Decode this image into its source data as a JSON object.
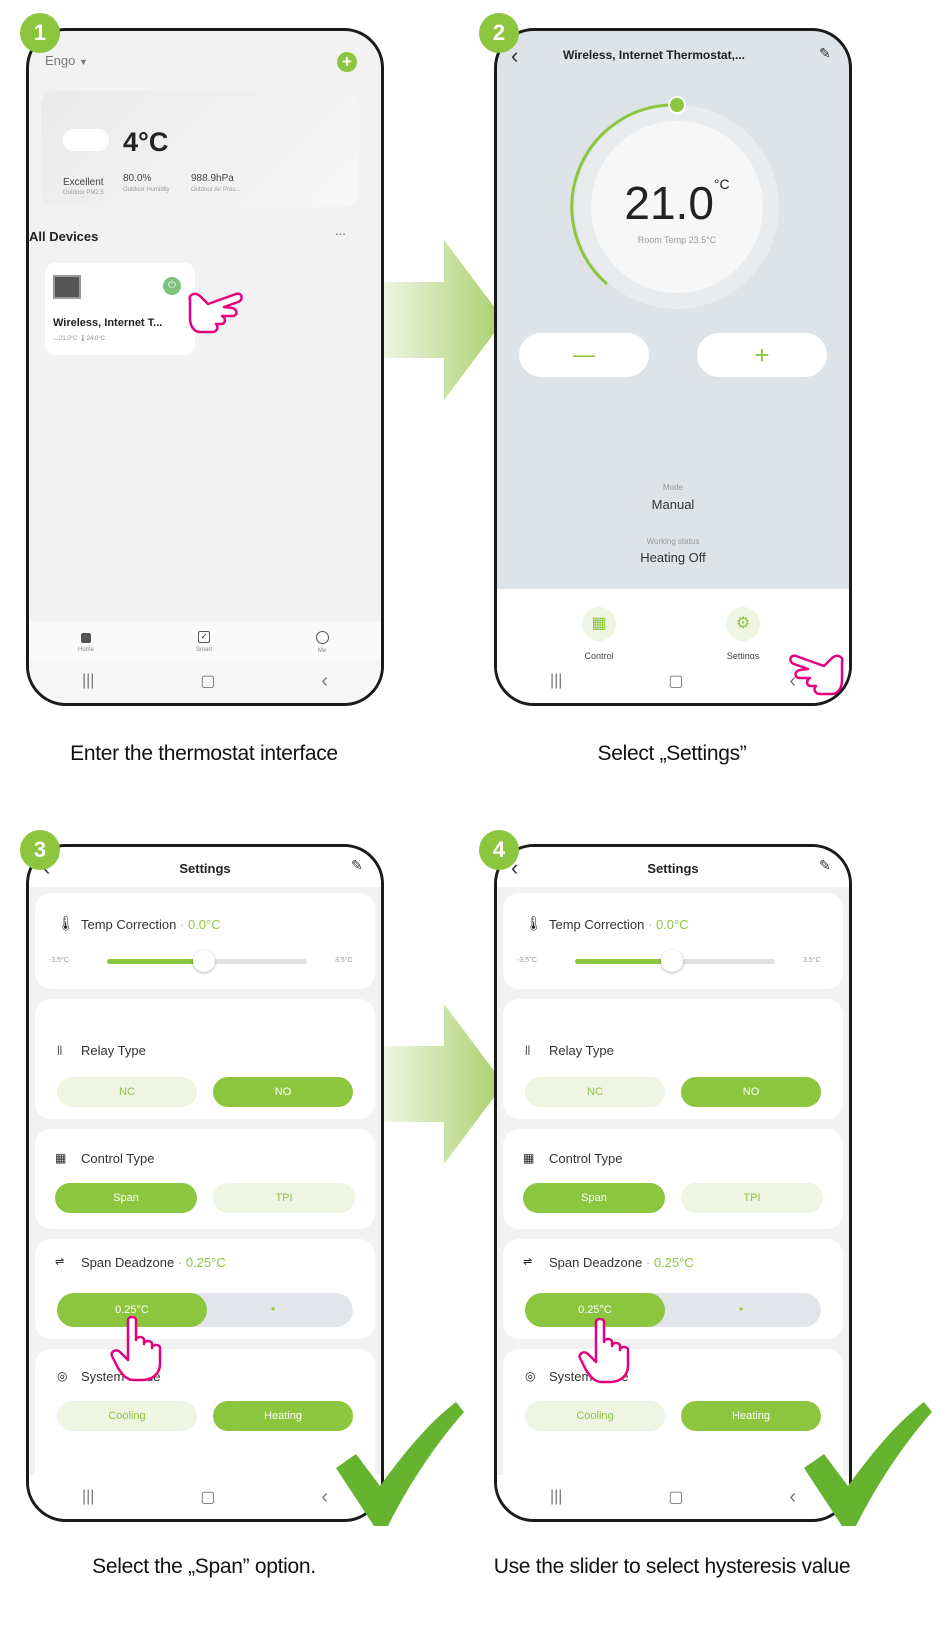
{
  "steps": [
    {
      "number": "1",
      "caption": "Enter the thermostat interface"
    },
    {
      "number": "2",
      "caption": "Select „Settings”"
    },
    {
      "number": "3",
      "caption": "Select the „Span” option."
    },
    {
      "number": "4",
      "caption": "Use the slider to select hysteresis value"
    }
  ],
  "screen1": {
    "home_name": "Engo",
    "weather": {
      "temp": "4°C",
      "air_quality": "Excellent",
      "air_quality_label": "Outdoor PM2.5",
      "humidity": "80.0%",
      "humidity_label": "Outdoor Humidity",
      "pressure": "988.9hPa",
      "pressure_label": "Outdoor Air Pres..."
    },
    "section_title": "All Devices",
    "more": "...",
    "device": {
      "name": "Wireless, Internet T...",
      "stats": "↔21.0°C  🌡24.0°C"
    },
    "tabs": [
      {
        "label": "Home",
        "icon": "home-icon"
      },
      {
        "label": "Smart",
        "icon": "checkbox-icon"
      },
      {
        "label": "Me",
        "icon": "profile-icon"
      }
    ]
  },
  "screen2": {
    "title": "Wireless, Internet Thermostat,...",
    "setpoint": "21.0",
    "unit": "°C",
    "room_temp": "Room Temp 23.5°C",
    "minus": "—",
    "plus": "+",
    "mode_label": "Mode",
    "mode_value": "Manual",
    "status_label": "Working status",
    "status_value": "Heating Off",
    "bottom": [
      {
        "label": "Control",
        "icon": "grid-icon"
      },
      {
        "label": "Settings",
        "icon": "gear-icon"
      }
    ]
  },
  "screen3": {
    "title": "Settings",
    "temp_correction_label": "Temp Correction",
    "temp_correction_value": "0.0°C",
    "slider_min": "-3.5°C",
    "slider_max": "3.5°C",
    "relay_label": "Relay Type",
    "relay_options": [
      "NC",
      "NO"
    ],
    "control_label": "Control Type",
    "control_options": [
      "Span",
      "TPI"
    ],
    "deadzone_label": "Span Deadzone",
    "deadzone_value": "0.25°C",
    "deadzone_slider_value": "0.25°C",
    "deadzone_dot": "•",
    "system_label": "System mode",
    "system_options": [
      "Cooling",
      "Heating"
    ]
  },
  "screen4": {
    "title": "Settings",
    "temp_correction_label": "Temp Correction",
    "temp_correction_value": "0.0°C",
    "slider_min": "-3.5°C",
    "slider_max": "3.5°C",
    "relay_label": "Relay Type",
    "relay_options": [
      "NC",
      "NO"
    ],
    "control_label": "Control Type",
    "control_options": [
      "Span",
      "TPI"
    ],
    "deadzone_label": "Span Deadzone",
    "deadzone_value": "0.25°C",
    "deadzone_slider_value": "0.25°C",
    "deadzone_dot": "•",
    "system_label": "System mode",
    "system_options": [
      "Cooling",
      "Heating"
    ]
  },
  "navbar": {
    "recent": "|||",
    "home": "▢",
    "back": "‹"
  },
  "colors": {
    "accent": "#8cc63f",
    "light_accent": "#eef5e2",
    "arrow": "#b8d98a"
  }
}
